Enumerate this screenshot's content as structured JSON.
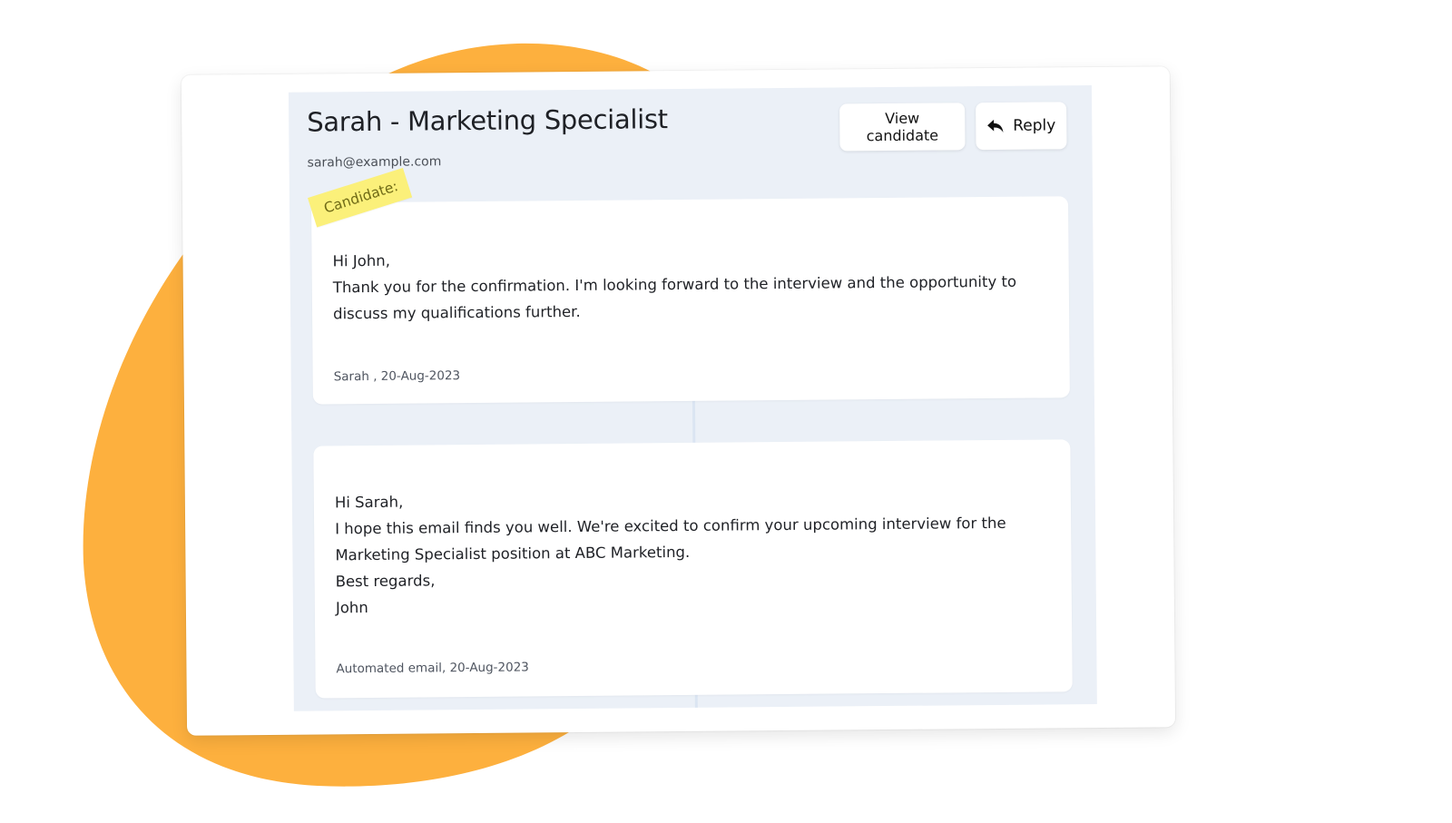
{
  "header": {
    "title": "Sarah - Marketing Specialist",
    "email": "sarah@example.com"
  },
  "actions": {
    "view_candidate_label": "View candidate",
    "reply_label": "Reply",
    "reply_icon": "reply-arrow-icon"
  },
  "tag": {
    "label": "Candidate:"
  },
  "messages": [
    {
      "lines": [
        "Hi John,",
        "Thank you for the confirmation. I'm looking forward to the interview and the opportunity to discuss my qualifications further."
      ],
      "meta": "Sarah , 20-Aug-2023"
    },
    {
      "lines": [
        "Hi Sarah,",
        "I hope this email finds you well. We're excited to confirm your upcoming interview for the Marketing Specialist position at ABC Marketing.",
        "Best regards,",
        "John"
      ],
      "meta": "Automated email, 20-Aug-2023"
    }
  ],
  "colors": {
    "blob": "#FDB03E",
    "panel_background": "#EBF0F7",
    "tag_highlight": "#FBF07A"
  }
}
